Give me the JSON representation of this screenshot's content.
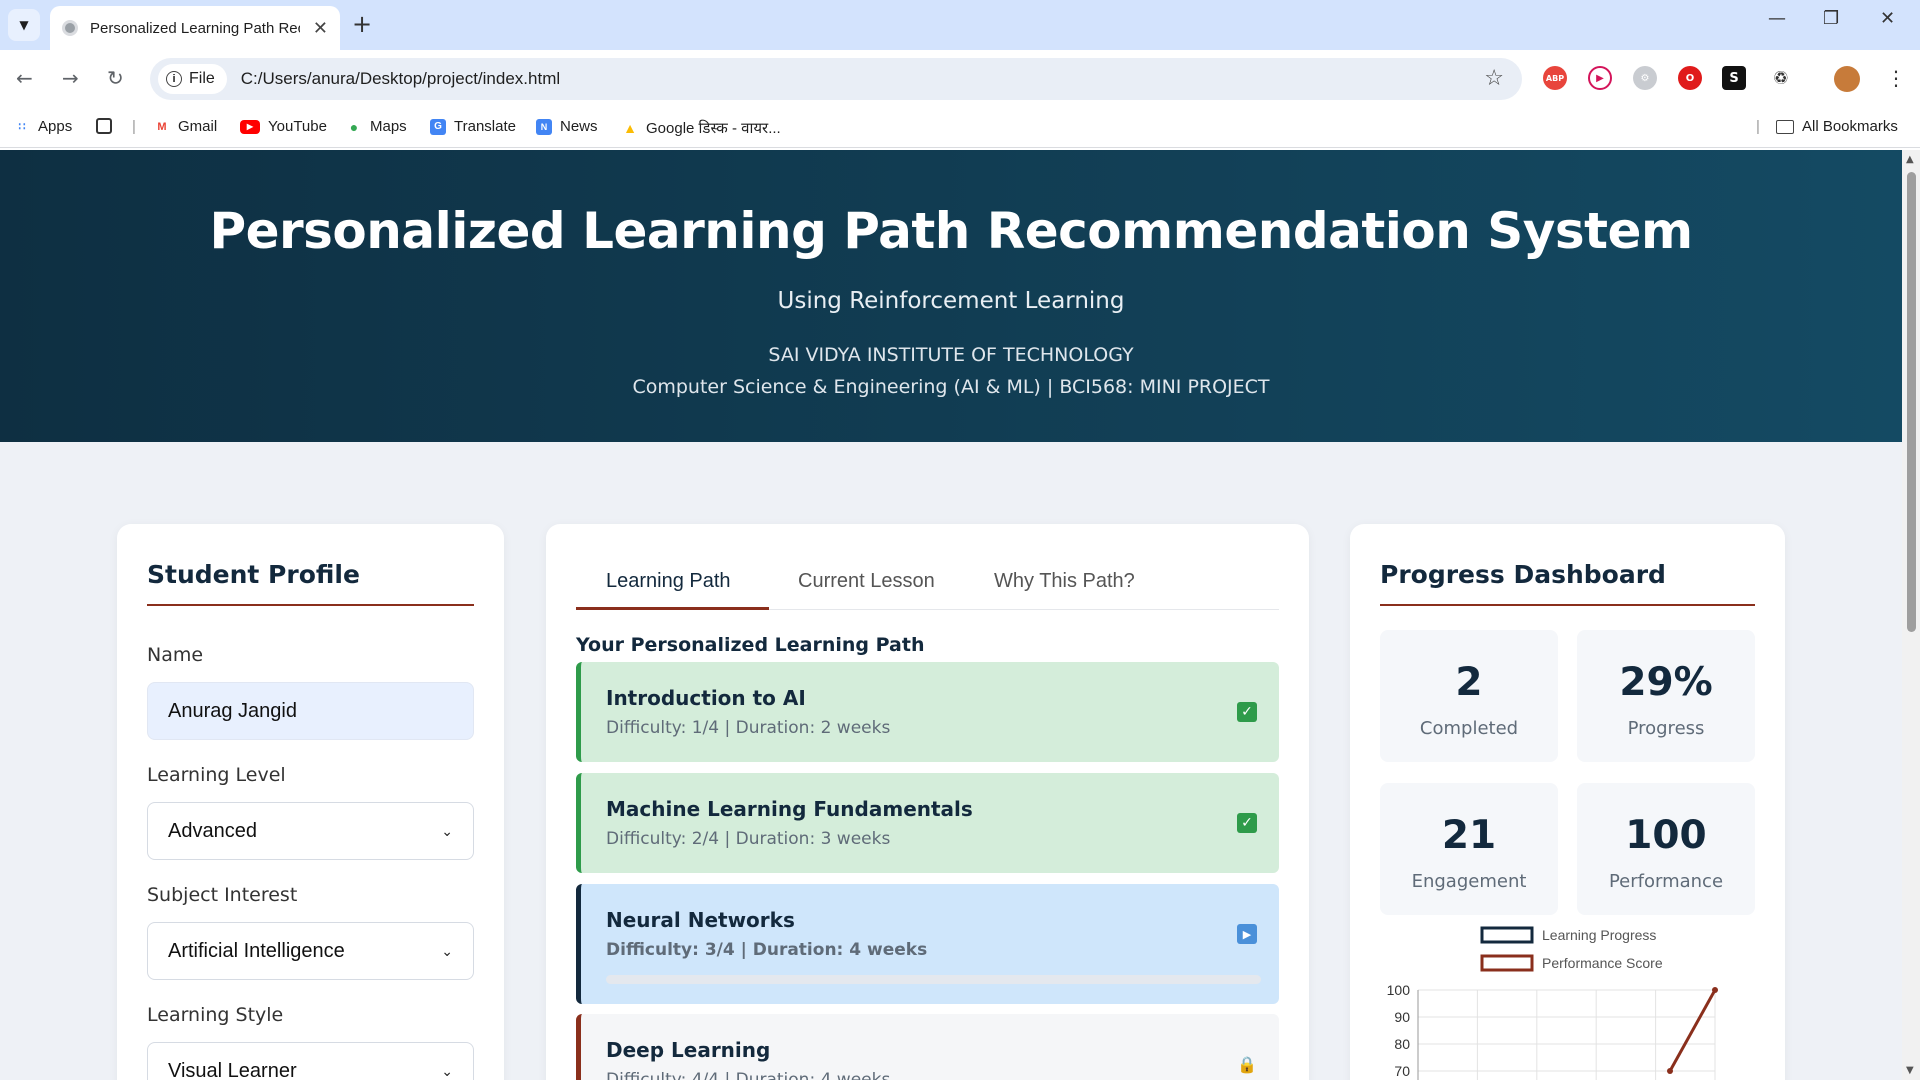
{
  "browser": {
    "tab_title": "Personalized Learning Path Rec",
    "address_scheme": "File",
    "url": "C:/Users/anura/Desktop/project/index.html",
    "bookmarks": [
      "Apps",
      "Gmail",
      "YouTube",
      "Maps",
      "Translate",
      "News",
      "Google डिस्क - वायर..."
    ],
    "all_bookmarks": "All Bookmarks",
    "extensions": [
      "ABP",
      "S"
    ]
  },
  "hero": {
    "title": "Personalized Learning Path Recommendation System",
    "subtitle": "Using Reinforcement Learning",
    "institute": "SAI VIDYA INSTITUTE OF TECHNOLOGY",
    "department": "Computer Science & Engineering (AI & ML) | BCI568: MINI PROJECT"
  },
  "profile": {
    "title": "Student Profile",
    "name_label": "Name",
    "name_value": "Anurag Jangid",
    "level_label": "Learning Level",
    "level_value": "Advanced",
    "interest_label": "Subject Interest",
    "interest_value": "Artificial Intelligence",
    "style_label": "Learning Style",
    "style_value": "Visual Learner"
  },
  "path": {
    "tabs": [
      "Learning Path",
      "Current Lesson",
      "Why This Path?"
    ],
    "active_tab": "Learning Path",
    "heading": "Your Personalized Learning Path",
    "courses": [
      {
        "name": "Introduction to AI",
        "meta": "Difficulty: 1/4 | Duration: 2 weeks",
        "status": "completed"
      },
      {
        "name": "Machine Learning Fundamentals",
        "meta": "Difficulty: 2/4 | Duration: 3 weeks",
        "status": "completed"
      },
      {
        "name": "Neural Networks",
        "meta": "Difficulty: 3/4 | Duration: 4 weeks",
        "status": "current",
        "progress": 0
      },
      {
        "name": "Deep Learning",
        "meta": "Difficulty: 4/4 | Duration: 4 weeks",
        "status": "locked"
      }
    ]
  },
  "dashboard": {
    "title": "Progress Dashboard",
    "stats": [
      {
        "value": "2",
        "label": "Completed"
      },
      {
        "value": "29%",
        "label": "Progress"
      },
      {
        "value": "21",
        "label": "Engagement"
      },
      {
        "value": "100",
        "label": "Performance"
      }
    ]
  },
  "chart_data": {
    "type": "line",
    "series": [
      {
        "name": "Learning Progress",
        "color": "#13293d",
        "values": []
      },
      {
        "name": "Performance Score",
        "color": "#8a2f1c",
        "values": [
          70,
          100
        ]
      }
    ],
    "y_ticks": [
      100,
      90,
      80,
      70
    ],
    "ylim": [
      70,
      100
    ],
    "legend": "top-center",
    "grid": true
  },
  "colors": {
    "hero_dark": "#0e2f42",
    "accent": "#8a2f1c",
    "completed": "#2e9b4a",
    "current": "#4a90d9"
  }
}
